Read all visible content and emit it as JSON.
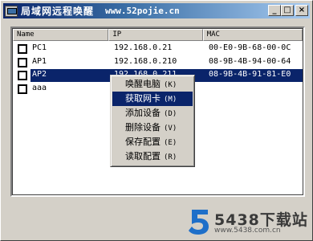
{
  "window": {
    "title": "局域网远程唤醒",
    "url": "www.52pojie.cn",
    "minimize_glyph": "_",
    "maximize_glyph": "□",
    "close_glyph": "×"
  },
  "columns": [
    "Name",
    "IP",
    "MAC"
  ],
  "rows": [
    {
      "name": "PC1",
      "ip": "192.168.0.21",
      "mac": "00-E0-9B-68-00-0C",
      "checked": false,
      "selected": false
    },
    {
      "name": "AP1",
      "ip": "192.168.0.210",
      "mac": "08-9B-4B-94-00-64",
      "checked": false,
      "selected": false
    },
    {
      "name": "AP2",
      "ip": "192.168.0.211",
      "mac": "08-9B-4B-91-81-E0",
      "checked": false,
      "selected": true
    },
    {
      "name": "aaa",
      "ip": "",
      "mac": "",
      "checked": false,
      "selected": false
    }
  ],
  "context_menu": [
    {
      "label": "唤醒电脑",
      "shortcut": "(K)",
      "highlighted": false
    },
    {
      "label": "获取网卡",
      "shortcut": "(M)",
      "highlighted": true
    },
    {
      "label": "添加设备",
      "shortcut": "(D)",
      "highlighted": false
    },
    {
      "label": "删除设备",
      "shortcut": "(V)",
      "highlighted": false
    },
    {
      "label": "保存配置",
      "shortcut": "(E)",
      "highlighted": false
    },
    {
      "label": "读取配置",
      "shortcut": "(R)",
      "highlighted": false
    }
  ],
  "watermark": {
    "brand": "5438下载站",
    "url": "www.5438.com.cn",
    "logo_color": "#1e6fc9"
  }
}
